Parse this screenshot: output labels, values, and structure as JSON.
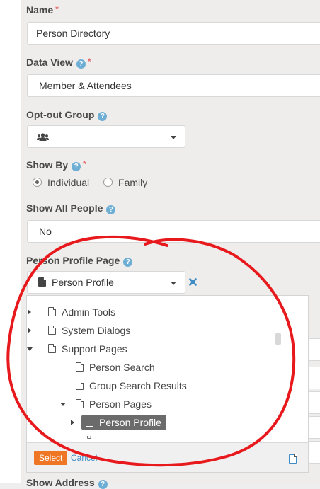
{
  "fields": {
    "name": {
      "label": "Name",
      "required_mark": "*",
      "value": "Person Directory"
    },
    "data_view": {
      "label": "Data View",
      "help": "?",
      "required_mark": "*",
      "value": "Member & Attendees"
    },
    "opt_out_group": {
      "label": "Opt-out Group",
      "help": "?",
      "value": ""
    },
    "show_by": {
      "label": "Show By",
      "help": "?",
      "required_mark": "*",
      "options": [
        {
          "label": "Individual",
          "checked": true
        },
        {
          "label": "Family",
          "checked": false
        }
      ]
    },
    "show_all_people": {
      "label": "Show All People",
      "help": "?",
      "value": "No"
    },
    "person_profile_page": {
      "label": "Person Profile Page",
      "help": "?",
      "value": "Person Profile"
    },
    "next_label_partial": "Show Address"
  },
  "tree": {
    "items": [
      {
        "label": "Admin Tools",
        "expanded": false
      },
      {
        "label": "System Dialogs",
        "expanded": false
      },
      {
        "label": "Support Pages",
        "expanded": true
      },
      {
        "label": "Person Search"
      },
      {
        "label": "Group Search Results"
      },
      {
        "label": "Person Pages",
        "expanded": true
      },
      {
        "label": "Person Profile",
        "selected": true,
        "expanded": false
      }
    ]
  },
  "picker_footer": {
    "select_label": "Select",
    "cancel_label": "Cancel"
  },
  "colors": {
    "accent": "#ee7625",
    "link": "#3d8cc4",
    "help": "#6eaed4",
    "annotation": "#e8191c"
  }
}
